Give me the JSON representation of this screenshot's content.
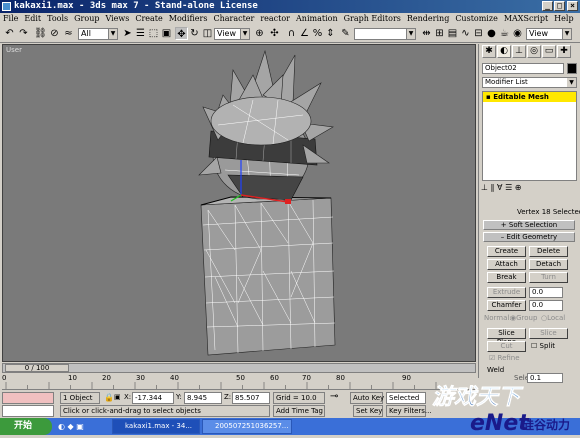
{
  "window": {
    "title": "kakaxi1.max - 3ds max 7 - Stand-alone License",
    "controls": [
      "_",
      "□",
      "×"
    ]
  },
  "menu": [
    "File",
    "Edit",
    "Tools",
    "Group",
    "Views",
    "Create",
    "Modifiers",
    "Character",
    "reactor",
    "Animation",
    "Graph Editors",
    "Rendering",
    "Customize",
    "MAXScript",
    "Help"
  ],
  "toolbar": {
    "selection_filter": "All",
    "ref_coord": "View",
    "named_selection": "",
    "right_dropdown": "View"
  },
  "viewport": {
    "label": "User",
    "background": "#7a7a7a"
  },
  "command_panel": {
    "object_name": "Object02",
    "object_color": "#000000",
    "modifier_list": "Modifier List",
    "stack_item": "Editable Mesh",
    "selection_status": "Vertex 18 Selected",
    "rollouts": {
      "soft_selection": "Soft Selection",
      "edit_geometry": "Edit Geometry"
    },
    "buttons": {
      "create": "Create",
      "delete": "Delete",
      "attach": "Attach",
      "detach": "Detach",
      "break": "Break",
      "turn": "Turn",
      "extrude": "Extrude",
      "extrude_value": "0.0",
      "chamfer": "Chamfer",
      "chamfer_value": "0.0",
      "normal_label": "Normal:",
      "group": "Group",
      "local": "Local",
      "slice_plane": "Slice Plane",
      "slice": "Slice",
      "cut": "Cut",
      "split": "Split",
      "refine": "Refine",
      "weld": "Weld",
      "selected": "Selected",
      "weld_value": "0.1"
    }
  },
  "timeline": {
    "frame_display": "0 / 100",
    "ticks": [
      "0",
      "10",
      "20",
      "30",
      "40",
      "50",
      "60",
      "70",
      "80",
      "90"
    ]
  },
  "status": {
    "selection_count": "1 Object",
    "x_label": "X:",
    "x_value": "-17.344",
    "y_label": "Y:",
    "y_value": "8.945",
    "z_label": "Z:",
    "z_value": "85.507",
    "grid": "Grid = 10.0",
    "auto_key": "Auto Key",
    "selected": "Selected",
    "set_key": "Set Key",
    "key_filters": "Key Filters...",
    "prompt": "Click or click-and-drag to select objects",
    "add_time_tag": "Add Time Tag"
  },
  "taskbar": {
    "start": "开始",
    "items": [
      "kakaxi1.max - 34...",
      "200507251036257..."
    ]
  },
  "watermark": {
    "text": "游戏天下 eNet 硅谷动力"
  }
}
